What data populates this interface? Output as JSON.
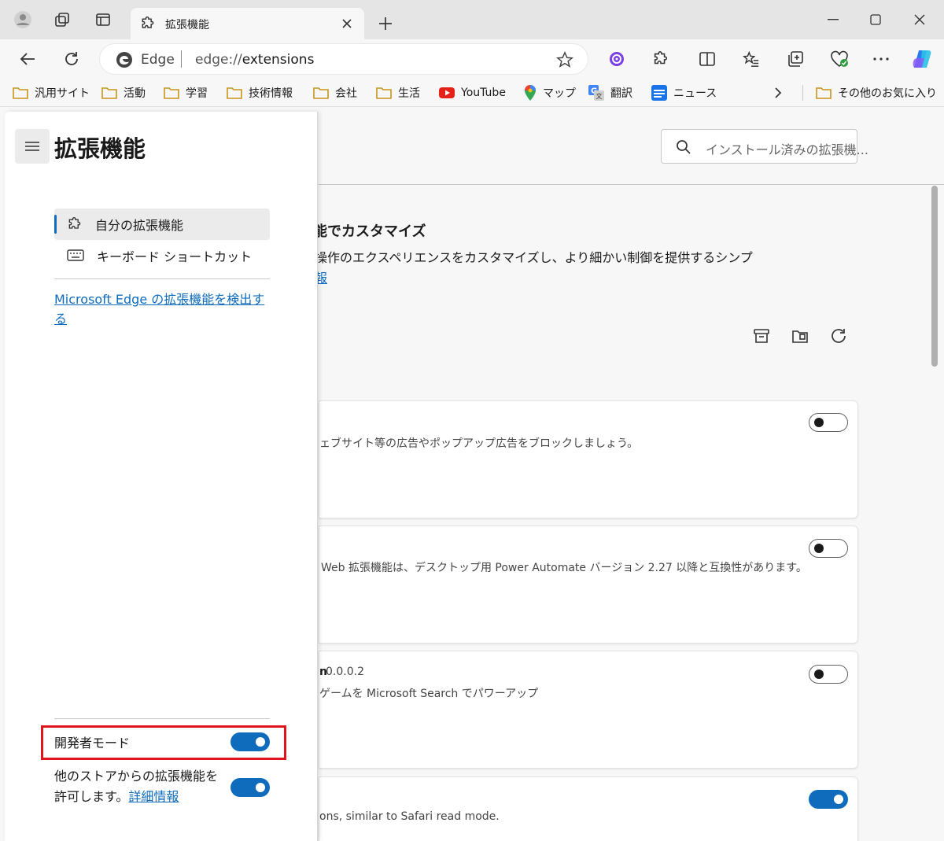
{
  "browser": {
    "tab_title": "拡張機能",
    "address_brand": "Edge",
    "address_scheme": "edge://",
    "address_path": "extensions"
  },
  "favorites": [
    {
      "label": "汎用サイト",
      "icon": "folder-icon"
    },
    {
      "label": "活動",
      "icon": "folder-icon"
    },
    {
      "label": "学習",
      "icon": "folder-icon"
    },
    {
      "label": "技術情報",
      "icon": "folder-icon"
    },
    {
      "label": "会社",
      "icon": "folder-icon"
    },
    {
      "label": "生活",
      "icon": "folder-icon"
    },
    {
      "label": "YouTube",
      "icon": "youtube-icon"
    },
    {
      "label": "マップ",
      "icon": "maps-pin-icon"
    },
    {
      "label": "翻訳",
      "icon": "translate-icon"
    },
    {
      "label": "ニュース",
      "icon": "news-icon"
    }
  ],
  "favorites_other": "その他のお気に入り",
  "sidebar": {
    "title": "拡張機能",
    "nav": [
      {
        "label": "自分の拡張機能",
        "active": true
      },
      {
        "label": "キーボード ショートカット",
        "active": false
      }
    ],
    "discover_link": "Microsoft Edge の拡張機能を検出する",
    "developer_mode_label": "開発者モード",
    "developer_mode_on": true,
    "allow_stores_label": "他のストアからの拡張機能を許可します。",
    "allow_stores_link": "詳細情報",
    "allow_stores_on": true
  },
  "main": {
    "search_placeholder": "インストール済みの拡張機...",
    "hero_title": "能でカスタマイズ",
    "hero_desc": "操作のエクスペリエンスをカスタマイズし、より細かい制御を提供するシンプ",
    "hero_link": "報",
    "cards": [
      {
        "name": "",
        "version": "",
        "desc": "ェブサイト等の広告やポップアップ広告をブロックしましょう。",
        "enabled": false
      },
      {
        "name": "",
        "version": "",
        "desc": "Web 拡張機能は、デスクトップ用 Power Automate バージョン 2.27 以降と互換性があります。",
        "enabled": false
      },
      {
        "name": "n",
        "version": "0.0.0.2",
        "desc": "ゲームを Microsoft Search でパワーアップ",
        "enabled": false
      },
      {
        "name": "",
        "version": "",
        "desc": "ons, similar to Safari read mode.",
        "enabled": true
      }
    ]
  },
  "colors": {
    "accent": "#0f6cbd",
    "highlight_box": "#e0141e"
  }
}
